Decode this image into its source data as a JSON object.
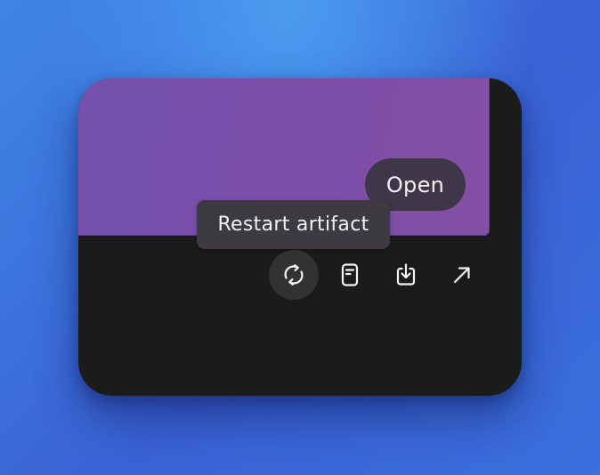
{
  "card": {
    "open_label": "Open",
    "tooltip": "Restart artifact",
    "toolbar": [
      {
        "name": "restart",
        "icon": "restart-icon",
        "active": true
      },
      {
        "name": "document",
        "icon": "document-icon",
        "active": false
      },
      {
        "name": "download",
        "icon": "download-icon",
        "active": false
      },
      {
        "name": "open-external",
        "icon": "arrow-up-right-icon",
        "active": false
      }
    ]
  },
  "colors": {
    "background": "#3a6fdc",
    "card": "#1b1b1b",
    "preview": "#7a4fab",
    "tooltip": "#3e3a41"
  }
}
